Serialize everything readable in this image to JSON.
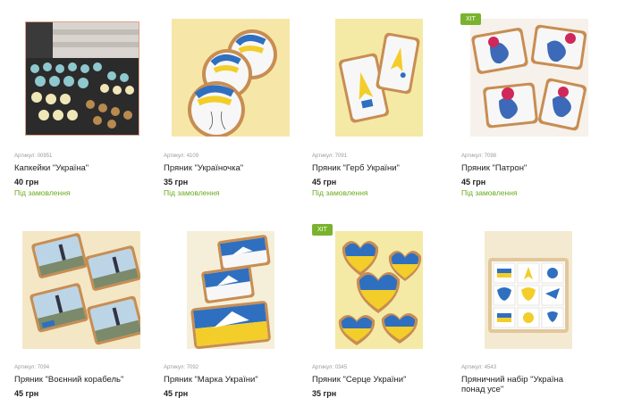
{
  "products": [
    {
      "sku": "Артикул: 00951",
      "name": "Капкейки \"Україна\"",
      "price": "40 грн",
      "status": "Під замовлення",
      "badge": ""
    },
    {
      "sku": "Артикул: 4109",
      "name": "Пряник \"Україночка\"",
      "price": "35 грн",
      "status": "Під замовлення",
      "badge": ""
    },
    {
      "sku": "Артикул: 7091",
      "name": "Пряник \"Герб України\"",
      "price": "45 грн",
      "status": "Під замовлення",
      "badge": ""
    },
    {
      "sku": "Артикул: 7098",
      "name": "Пряник \"Патрон\"",
      "price": "45 грн",
      "status": "Під замовлення",
      "badge": "ХІТ"
    },
    {
      "sku": "Артикул: 7094",
      "name": "Пряник \"Воєнний корабель\"",
      "price": "45 грн",
      "status": "",
      "badge": ""
    },
    {
      "sku": "Артикул: 7092",
      "name": "Пряник \"Марка України\"",
      "price": "45 грн",
      "status": "",
      "badge": ""
    },
    {
      "sku": "Артикул: 0345",
      "name": "Пряник \"Серце України\"",
      "price": "35 грн",
      "status": "",
      "badge": "ХІТ"
    },
    {
      "sku": "Артикул: 4543",
      "name": "Пряничний набір \"Україна понад усе\"",
      "price": "",
      "status": "",
      "badge": ""
    }
  ],
  "colors": {
    "accent_green": "#79b32e",
    "status_green": "#6aaa1f",
    "flag_blue": "#2f6fc0",
    "flag_yellow": "#f3cd2a",
    "cream_bg": "#f5efc9"
  }
}
